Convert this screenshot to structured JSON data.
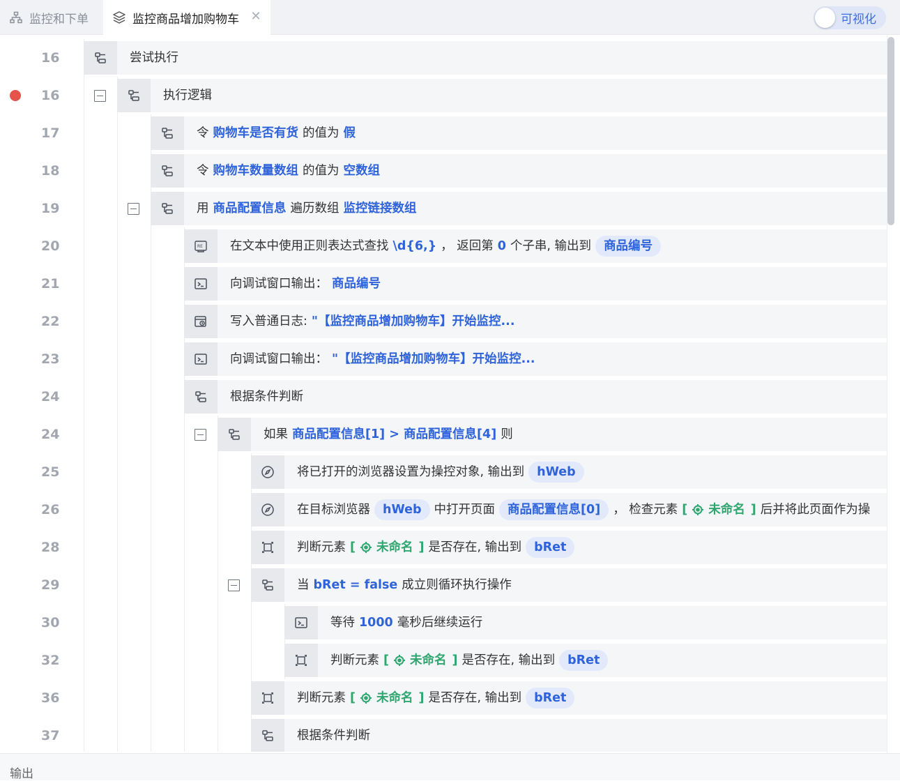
{
  "tabs": [
    {
      "label": "监控和下单",
      "icon": "sitemap-icon",
      "active": false
    },
    {
      "label": "监控商品增加购物车",
      "icon": "layers-icon",
      "active": true,
      "close": "✕"
    }
  ],
  "toggle": {
    "label": "可视化",
    "on": false
  },
  "rows": [
    {
      "line": "16",
      "bp": false,
      "depth": 0,
      "collapse": false,
      "icon": "branch-icon",
      "parts": [
        {
          "t": "text",
          "v": "尝试执行"
        }
      ]
    },
    {
      "line": "16",
      "bp": true,
      "depth": 1,
      "collapse": true,
      "icon": "branch-icon",
      "parts": [
        {
          "t": "text",
          "v": "执行逻辑"
        }
      ]
    },
    {
      "line": "17",
      "bp": false,
      "depth": 2,
      "collapse": false,
      "icon": "branch-icon",
      "parts": [
        {
          "t": "text",
          "v": "令"
        },
        {
          "t": "kw",
          "v": "购物车是否有货"
        },
        {
          "t": "text",
          "v": "的值为"
        },
        {
          "t": "kw",
          "v": "假"
        }
      ]
    },
    {
      "line": "18",
      "bp": false,
      "depth": 2,
      "collapse": false,
      "icon": "branch-icon",
      "parts": [
        {
          "t": "text",
          "v": "令"
        },
        {
          "t": "kw",
          "v": "购物车数量数组"
        },
        {
          "t": "text",
          "v": "的值为"
        },
        {
          "t": "kw",
          "v": "空数组"
        }
      ]
    },
    {
      "line": "19",
      "bp": false,
      "depth": 2,
      "collapse": true,
      "icon": "branch-icon",
      "parts": [
        {
          "t": "text",
          "v": "用"
        },
        {
          "t": "kw",
          "v": "商品配置信息"
        },
        {
          "t": "text",
          "v": "遍历数组"
        },
        {
          "t": "kw",
          "v": "监控链接数组"
        }
      ]
    },
    {
      "line": "20",
      "bp": false,
      "depth": 3,
      "collapse": false,
      "icon": "regex-icon",
      "parts": [
        {
          "t": "text",
          "v": "在文本中使用正则表达式查找"
        },
        {
          "t": "kw",
          "v": "\\d{6,}"
        },
        {
          "t": "text",
          "v": "， 返回第"
        },
        {
          "t": "kw",
          "v": "0"
        },
        {
          "t": "text",
          "v": "个子串, 输出到"
        },
        {
          "t": "pill",
          "v": "商品编号"
        }
      ]
    },
    {
      "line": "21",
      "bp": false,
      "depth": 3,
      "collapse": false,
      "icon": "terminal-icon",
      "parts": [
        {
          "t": "text",
          "v": "向调试窗口输出："
        },
        {
          "t": "kw",
          "v": "商品编号"
        }
      ]
    },
    {
      "line": "22",
      "bp": false,
      "depth": 3,
      "collapse": false,
      "icon": "log-icon",
      "parts": [
        {
          "t": "text",
          "v": "写入普通日志:"
        },
        {
          "t": "kw",
          "v": "\"【监控商品增加购物车】开始监控..."
        }
      ]
    },
    {
      "line": "23",
      "bp": false,
      "depth": 3,
      "collapse": false,
      "icon": "terminal-icon",
      "parts": [
        {
          "t": "text",
          "v": "向调试窗口输出："
        },
        {
          "t": "kw",
          "v": "\"【监控商品增加购物车】开始监控..."
        }
      ]
    },
    {
      "line": "24",
      "bp": false,
      "depth": 3,
      "collapse": false,
      "icon": "branch-icon",
      "parts": [
        {
          "t": "text",
          "v": "根据条件判断"
        }
      ]
    },
    {
      "line": "24",
      "bp": false,
      "depth": 4,
      "collapse": true,
      "icon": "branch-icon",
      "parts": [
        {
          "t": "text",
          "v": "如果"
        },
        {
          "t": "kw",
          "v": "商品配置信息[1] > 商品配置信息[4]"
        },
        {
          "t": "text",
          "v": "则"
        }
      ]
    },
    {
      "line": "25",
      "bp": false,
      "depth": 5,
      "collapse": false,
      "icon": "compass-icon",
      "parts": [
        {
          "t": "text",
          "v": "将已打开的浏览器设置为操控对象, 输出到"
        },
        {
          "t": "pill",
          "v": "hWeb"
        }
      ]
    },
    {
      "line": "26",
      "bp": false,
      "depth": 5,
      "collapse": false,
      "icon": "compass-icon",
      "parts": [
        {
          "t": "text",
          "v": "在目标浏览器"
        },
        {
          "t": "pill",
          "v": "hWeb"
        },
        {
          "t": "text",
          "v": "中打开页面"
        },
        {
          "t": "pill",
          "v": "商品配置信息[0]"
        },
        {
          "t": "text",
          "v": "， 检查元素"
        },
        {
          "t": "target",
          "v": "未命名"
        },
        {
          "t": "text",
          "v": "后并将此页面作为操"
        }
      ]
    },
    {
      "line": "28",
      "bp": false,
      "depth": 5,
      "collapse": false,
      "icon": "element-icon",
      "parts": [
        {
          "t": "text",
          "v": "判断元素"
        },
        {
          "t": "target",
          "v": "未命名"
        },
        {
          "t": "text",
          "v": "是否存在, 输出到"
        },
        {
          "t": "pill",
          "v": "bRet"
        }
      ]
    },
    {
      "line": "29",
      "bp": false,
      "depth": 5,
      "collapse": true,
      "icon": "branch-icon",
      "parts": [
        {
          "t": "text",
          "v": "当"
        },
        {
          "t": "kw",
          "v": "bRet = false"
        },
        {
          "t": "text",
          "v": "成立则循环执行操作"
        }
      ]
    },
    {
      "line": "30",
      "bp": false,
      "depth": 6,
      "collapse": false,
      "icon": "terminal-icon",
      "parts": [
        {
          "t": "text",
          "v": "等待"
        },
        {
          "t": "kw",
          "v": "1000"
        },
        {
          "t": "text",
          "v": "毫秒后继续运行"
        }
      ]
    },
    {
      "line": "32",
      "bp": false,
      "depth": 6,
      "collapse": false,
      "icon": "element-icon",
      "parts": [
        {
          "t": "text",
          "v": "判断元素"
        },
        {
          "t": "target",
          "v": "未命名"
        },
        {
          "t": "text",
          "v": "是否存在, 输出到"
        },
        {
          "t": "pill",
          "v": "bRet"
        }
      ]
    },
    {
      "line": "36",
      "bp": false,
      "depth": 5,
      "collapse": false,
      "icon": "element-icon",
      "parts": [
        {
          "t": "text",
          "v": "判断元素"
        },
        {
          "t": "target",
          "v": "未命名"
        },
        {
          "t": "text",
          "v": "是否存在, 输出到"
        },
        {
          "t": "pill",
          "v": "bRet"
        }
      ]
    },
    {
      "line": "37",
      "bp": false,
      "depth": 5,
      "collapse": false,
      "icon": "branch-icon",
      "parts": [
        {
          "t": "text",
          "v": "根据条件判断"
        }
      ]
    }
  ],
  "output_panel": {
    "label": "输出"
  },
  "colors": {
    "accent": "#2f63d9",
    "pill_bg": "#e1e9fb",
    "target_green": "#2fa66f",
    "breakpoint": "#e5534b"
  }
}
